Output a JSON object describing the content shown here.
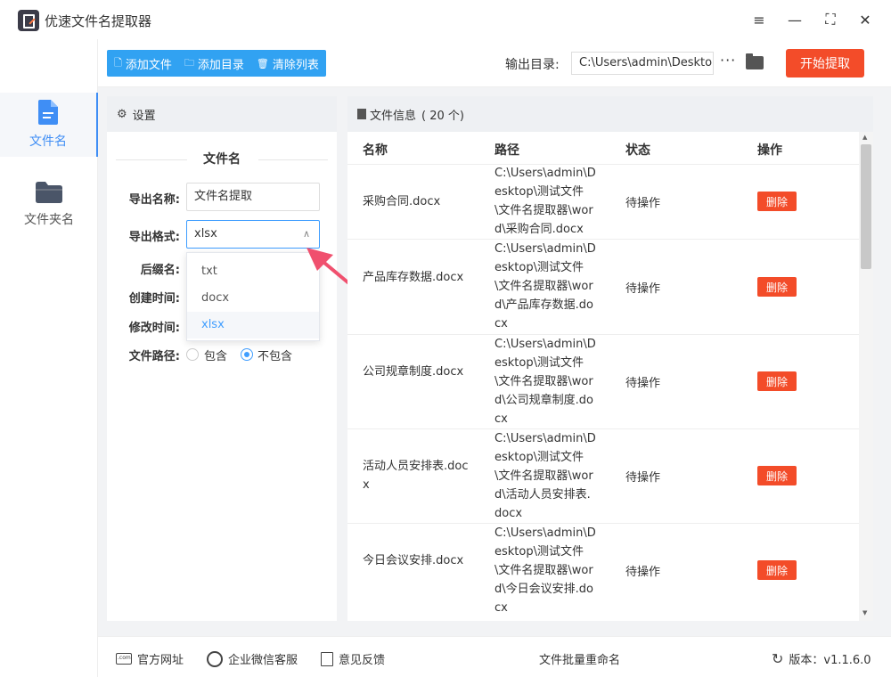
{
  "app": {
    "title": "优速文件名提取器"
  },
  "window": {
    "menu_icon": "≡",
    "min_icon": "—",
    "max_icon": "⛶",
    "close_icon": "✕"
  },
  "nav": [
    {
      "label": "文件名",
      "icon": "file-icon",
      "active": true
    },
    {
      "label": "文件夹名",
      "icon": "folder-icon",
      "active": false
    }
  ],
  "toolbar": {
    "add_file": "添加文件",
    "add_dir": "添加目录",
    "clear_list": "清除列表",
    "output_label": "输出目录:",
    "output_value": "C:\\Users\\admin\\Deskto",
    "dots": "···",
    "start": "开始提取"
  },
  "settings": {
    "header": "设置",
    "section": "文件名",
    "export_name_label": "导出名称:",
    "export_name_value": "文件名提取",
    "export_format_label": "导出格式:",
    "export_format_value": "xlsx",
    "format_options": [
      "txt",
      "docx",
      "xlsx"
    ],
    "selected_option": "xlsx",
    "suffix_label": "后缀名:",
    "created_label": "创建时间:",
    "modified_label": "修改时间:",
    "path_label": "文件路径:",
    "path_include": "包含",
    "path_exclude": "不包含",
    "path_selected": "不包含"
  },
  "files": {
    "header": "文件信息",
    "count": "( 20 个)",
    "columns": {
      "name": "名称",
      "path": "路径",
      "status": "状态",
      "action": "操作"
    },
    "rows": [
      {
        "name": "采购合同.docx",
        "path": "C:\\Users\\admin\\Desktop\\测试文件\\文件名提取器\\word\\采购合同.docx",
        "status": "待操作",
        "action": "删除"
      },
      {
        "name": "产品库存数据.docx",
        "path": "C:\\Users\\admin\\Desktop\\测试文件\\文件名提取器\\word\\产品库存数据.docx",
        "status": "待操作",
        "action": "删除"
      },
      {
        "name": "公司规章制度.docx",
        "path": "C:\\Users\\admin\\Desktop\\测试文件\\文件名提取器\\word\\公司规章制度.docx",
        "status": "待操作",
        "action": "删除"
      },
      {
        "name": "活动人员安排表.docx",
        "path": "C:\\Users\\admin\\Desktop\\测试文件\\文件名提取器\\word\\活动人员安排表.docx",
        "status": "待操作",
        "action": "删除"
      },
      {
        "name": "今日会议安排.docx",
        "path": "C:\\Users\\admin\\Desktop\\测试文件\\文件名提取器\\word\\今日会议安排.docx",
        "status": "待操作",
        "action": "删除"
      }
    ]
  },
  "statusbar": {
    "website": "官方网址",
    "wechat": "企业微信客服",
    "feedback": "意见反馈",
    "center": "文件批量重命名",
    "version": "版本：v1.1.6.0"
  },
  "colors": {
    "accent": "#31a2f2",
    "danger": "#f34c29",
    "link": "#409eff"
  }
}
